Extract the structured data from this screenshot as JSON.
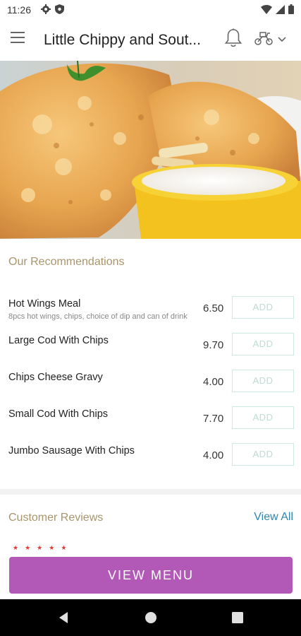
{
  "status_bar": {
    "time": "11:26",
    "icons_left": [
      "settings-icon",
      "shield-icon"
    ],
    "icons_right": [
      "wifi-icon",
      "signal-icon",
      "battery-icon"
    ]
  },
  "app_bar": {
    "title": "Little Chippy and Sout...",
    "menu_icon": "hamburger-menu-icon",
    "notification_icon": "bell-icon",
    "delivery_icon": "scooter-icon",
    "dropdown_icon": "chevron-down-icon"
  },
  "hero": {
    "image": "fried-fish-and-chips-with-dip"
  },
  "recommendations": {
    "title": "Our Recommendations",
    "add_label": "ADD",
    "items": [
      {
        "name": "Hot Wings Meal",
        "description": "8pcs hot wings, chips, choice of dip and can of drink",
        "price": "6.50"
      },
      {
        "name": "Large Cod With Chips",
        "description": "",
        "price": "9.70"
      },
      {
        "name": "Chips Cheese Gravy",
        "description": "",
        "price": "4.00"
      },
      {
        "name": "Small Cod With Chips",
        "description": "",
        "price": "7.70"
      },
      {
        "name": "Jumbo Sausage With Chips",
        "description": "",
        "price": "4.00"
      }
    ]
  },
  "reviews": {
    "title": "Customer Reviews",
    "view_all_label": "View All",
    "rating": 5
  },
  "view_menu_label": "VIEW MENU",
  "colors": {
    "accent_purple": "#b258b6",
    "section_title": "#a8956b",
    "link_blue": "#2f85b0",
    "add_border": "#cfe8e0",
    "star_red": "#e53935"
  }
}
